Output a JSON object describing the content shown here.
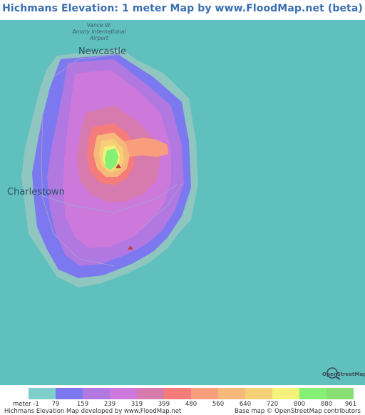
{
  "title": "Hichmans Elevation: 1 meter Map by www.FloodMap.net (beta)",
  "map": {
    "labels": {
      "newcastle": "Newcastle",
      "charlestown": "Charlestown",
      "airport_line1": "Vance W.",
      "airport_line2": "Amory International",
      "airport_line3": "Airport"
    },
    "osm_badge": "OpenStreetMap"
  },
  "legend": {
    "unit": "meter",
    "ticks": [
      "-1",
      "79",
      "159",
      "239",
      "319",
      "399",
      "480",
      "560",
      "640",
      "720",
      "800",
      "880",
      "961"
    ],
    "colors": [
      "#7ecfcc",
      "#7b78f0",
      "#b078e0",
      "#cd79dc",
      "#d77aae",
      "#f57c7b",
      "#f89e7c",
      "#f7b97a",
      "#f6d077",
      "#f4f27a",
      "#84f076",
      "#89de74"
    ]
  },
  "footer": {
    "left": "Hichmans Elevation Map developed by www.FloodMap.net",
    "right": "Base map © OpenStreetMap contributors"
  }
}
